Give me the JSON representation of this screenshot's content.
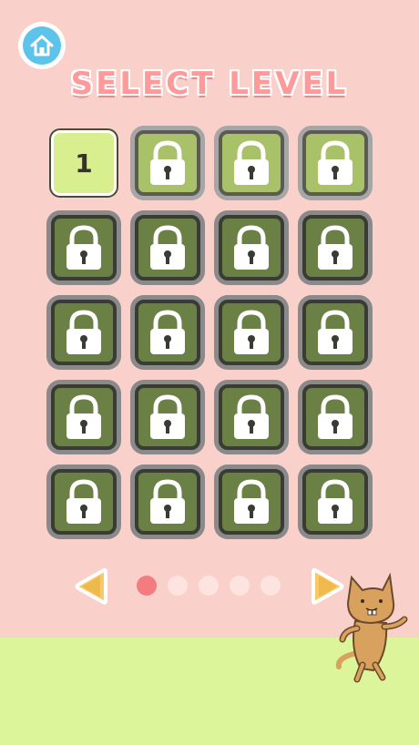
{
  "header": {
    "home_icon": "home-icon",
    "title": "SELECT LEVEL"
  },
  "levels": [
    {
      "label": "1",
      "state": "unlocked"
    },
    {
      "label": "",
      "state": "locked"
    },
    {
      "label": "",
      "state": "locked"
    },
    {
      "label": "",
      "state": "locked"
    },
    {
      "label": "",
      "state": "locked"
    },
    {
      "label": "",
      "state": "locked"
    },
    {
      "label": "",
      "state": "locked"
    },
    {
      "label": "",
      "state": "locked"
    },
    {
      "label": "",
      "state": "locked"
    },
    {
      "label": "",
      "state": "locked"
    },
    {
      "label": "",
      "state": "locked"
    },
    {
      "label": "",
      "state": "locked"
    },
    {
      "label": "",
      "state": "locked"
    },
    {
      "label": "",
      "state": "locked"
    },
    {
      "label": "",
      "state": "locked"
    },
    {
      "label": "",
      "state": "locked"
    },
    {
      "label": "",
      "state": "locked"
    },
    {
      "label": "",
      "state": "locked"
    },
    {
      "label": "",
      "state": "locked"
    },
    {
      "label": "",
      "state": "locked"
    }
  ],
  "pagination": {
    "pages": 5,
    "current": 1
  },
  "colors": {
    "background": "#fad0cb",
    "title": "#ff9a9a",
    "unlocked_tile": "#d9ef8f",
    "locked_tile": "#6b8044",
    "dot_active": "#f27c80",
    "dot_inactive": "#fde4e1",
    "arrow": "#f6c96a",
    "ground": "#dcf59a"
  }
}
